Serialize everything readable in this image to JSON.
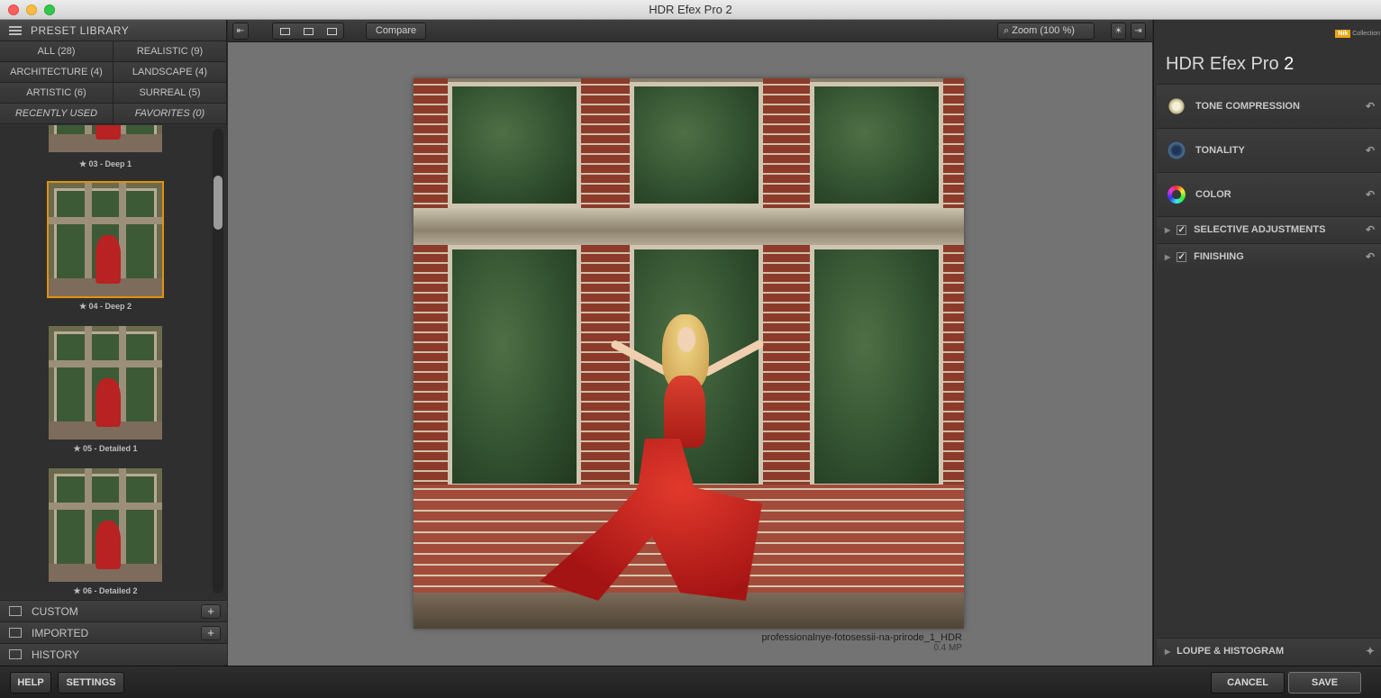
{
  "window": {
    "title": "HDR Efex Pro 2"
  },
  "library": {
    "title": "PRESET LIBRARY",
    "categories": [
      "ALL (28)",
      "REALISTIC (9)",
      "ARCHITECTURE (4)",
      "LANDSCAPE (4)",
      "ARTISTIC (6)",
      "SURREAL (5)",
      "RECENTLY USED",
      "FAVORITES (0)"
    ],
    "presets": [
      {
        "label": "★ 03 - Deep 1"
      },
      {
        "label": "★ 04 - Deep 2"
      },
      {
        "label": "★ 05 - Detailed 1"
      },
      {
        "label": "★ 06 - Detailed 2"
      }
    ],
    "sections": [
      "CUSTOM",
      "IMPORTED",
      "HISTORY"
    ],
    "plus": "+"
  },
  "toolbar": {
    "compare": "Compare",
    "zoom": "Zoom (100 %)"
  },
  "image": {
    "filename": "professionalnye-fotosessii-na-prirode_1_HDR",
    "size": "0.4 MP"
  },
  "panel": {
    "brand_badge": "Nik",
    "brand_text": "Collection",
    "title_main": "HDR Efex Pro",
    "title_num": "2",
    "rows": [
      "TONE COMPRESSION",
      "TONALITY",
      "COLOR"
    ],
    "sub_rows": [
      "SELECTIVE ADJUSTMENTS",
      "FINISHING"
    ],
    "loupe": "LOUPE & HISTOGRAM"
  },
  "buttons": {
    "help": "HELP",
    "settings": "SETTINGS",
    "cancel": "CANCEL",
    "save": "SAVE"
  },
  "icons": {
    "undo": "↶",
    "check": "✓",
    "triangle": "▶",
    "pin": "✦"
  }
}
